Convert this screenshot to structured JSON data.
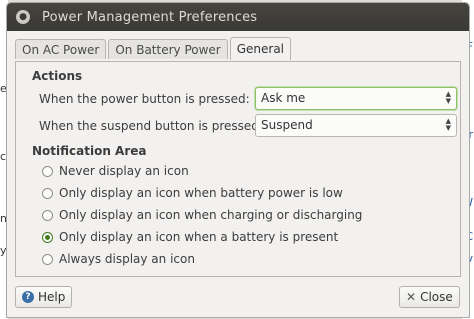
{
  "background": {
    "left_glyphs": [
      "e",
      "c",
      "n",
      "y"
    ],
    "right_glyphs": [
      "F",
      "tr",
      "W",
      "C",
      "v"
    ]
  },
  "window": {
    "title": "Power Management Preferences",
    "menu_glyph": "●"
  },
  "tabs": [
    {
      "label": "On AC Power",
      "active": false
    },
    {
      "label": "On Battery Power",
      "active": false
    },
    {
      "label": "General",
      "active": true
    }
  ],
  "actions": {
    "heading": "Actions",
    "power_button": {
      "label": "When the power button is pressed:",
      "value": "Ask me"
    },
    "suspend_button": {
      "label": "When the suspend button is pressed:",
      "value": "Suspend"
    }
  },
  "notification": {
    "heading": "Notification Area",
    "options": [
      {
        "label": "Never display an icon",
        "checked": false
      },
      {
        "label": "Only display an icon when battery power is low",
        "checked": false
      },
      {
        "label": "Only display an icon when charging or discharging",
        "checked": false
      },
      {
        "label": "Only display an icon when a battery is present",
        "checked": true
      },
      {
        "label": "Always display an icon",
        "checked": false
      }
    ]
  },
  "footer": {
    "help_label": "Help",
    "close_label": "Close"
  },
  "icons": {
    "help": "help-icon",
    "close": "close-icon",
    "combo_arrows": "updown-arrows-icon"
  }
}
